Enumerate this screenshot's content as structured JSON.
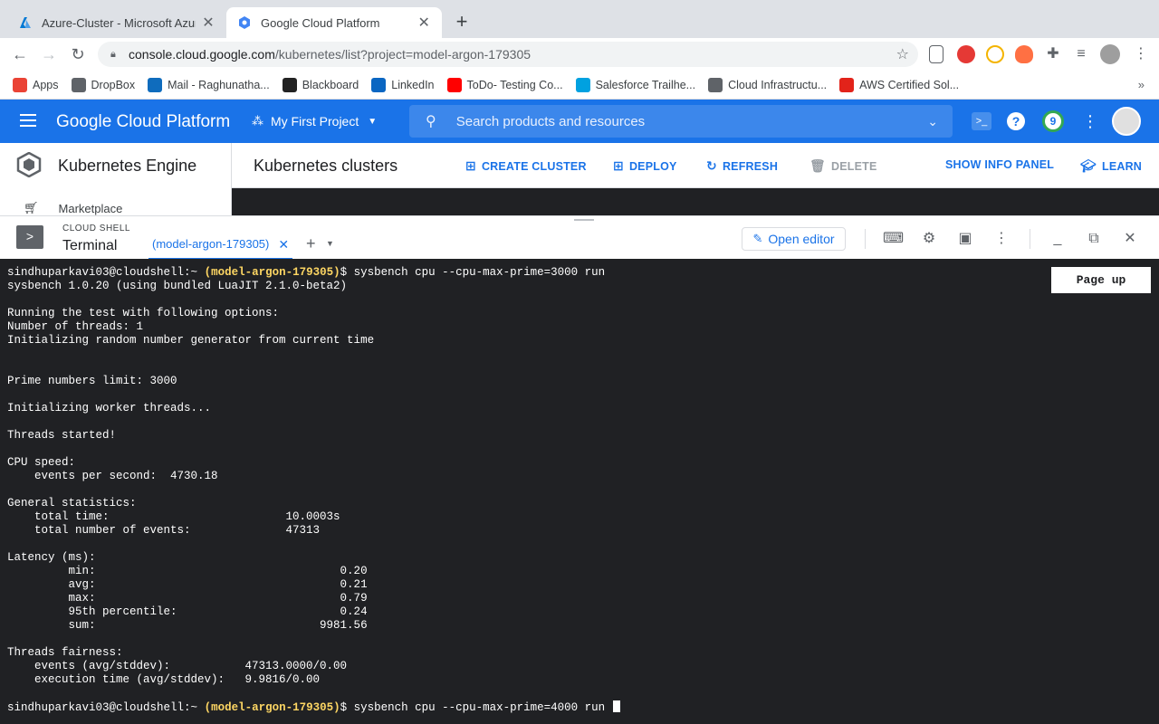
{
  "browser": {
    "tabs": [
      {
        "title": "Azure-Cluster - Microsoft Azure",
        "active": false
      },
      {
        "title": "Google Cloud Platform",
        "active": true
      }
    ],
    "url_host": "console.cloud.google.com",
    "url_path": "/kubernetes/list?project=model-argon-179305",
    "bookmarks": [
      {
        "label": "Apps",
        "icon": "apps-grid-icon",
        "color": "#ea4335"
      },
      {
        "label": "DropBox",
        "icon": "globe-icon",
        "color": "#5f6368"
      },
      {
        "label": "Mail - Raghunatha...",
        "icon": "outlook-icon",
        "color": "#0f6cbd"
      },
      {
        "label": "Blackboard",
        "icon": "blackboard-icon",
        "color": "#222222"
      },
      {
        "label": "LinkedIn",
        "icon": "linkedin-icon",
        "color": "#0a66c2"
      },
      {
        "label": "ToDo- Testing Co...",
        "icon": "youtube-icon",
        "color": "#ff0000"
      },
      {
        "label": "Salesforce Trailhe...",
        "icon": "salesforce-icon",
        "color": "#00a1e0"
      },
      {
        "label": "Cloud Infrastructu...",
        "icon": "globe-icon",
        "color": "#5f6368"
      },
      {
        "label": "AWS Certified Sol...",
        "icon": "acloud-icon",
        "color": "#e2231a"
      }
    ],
    "bookmarks_more": "»"
  },
  "gcp": {
    "title": "Google Cloud Platform",
    "project": "My First Project",
    "search_placeholder": "Search products and resources",
    "notifications_count": "9",
    "accent": "#1a73e8"
  },
  "gke": {
    "product": "Kubernetes Engine",
    "page_title": "Kubernetes clusters",
    "nav_item": "Marketplace",
    "actions": {
      "create": "CREATE CLUSTER",
      "deploy": "DEPLOY",
      "refresh": "REFRESH",
      "delete": "DELETE",
      "info_panel": "SHOW INFO PANEL",
      "learn": "LEARN"
    }
  },
  "shell": {
    "caption": "CLOUD SHELL",
    "title": "Terminal",
    "tab": "(model-argon-179305)",
    "open_editor": "Open editor",
    "page_up": "Page up",
    "prompt_user": "sindhuparkavi03@cloudshell:~",
    "prompt_project": "(model-argon-179305)",
    "command1": "$ sysbench cpu --cpu-max-prime=3000 run",
    "command2": "$ sysbench cpu --cpu-max-prime=4000 run",
    "output": [
      "sysbench 1.0.20 (using bundled LuaJIT 2.1.0-beta2)",
      "",
      "Running the test with following options:",
      "Number of threads: 1",
      "Initializing random number generator from current time",
      "",
      "",
      "Prime numbers limit: 3000",
      "",
      "Initializing worker threads...",
      "",
      "Threads started!",
      "",
      "CPU speed:",
      "    events per second:  4730.18",
      "",
      "General statistics:",
      "    total time:                          10.0003s",
      "    total number of events:              47313",
      "",
      "Latency (ms):",
      "         min:                                    0.20",
      "         avg:                                    0.21",
      "         max:                                    0.79",
      "         95th percentile:                        0.24",
      "         sum:                                 9981.56",
      "",
      "Threads fairness:",
      "    events (avg/stddev):           47313.0000/0.00",
      "    execution time (avg/stddev):   9.9816/0.00",
      ""
    ]
  }
}
